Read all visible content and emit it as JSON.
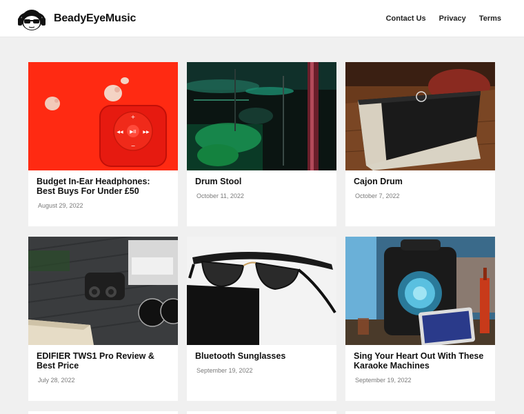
{
  "site": {
    "brand": "BeadyEyeMusic",
    "logo_icon": "headphones-face-logo-icon"
  },
  "nav": {
    "items": [
      {
        "label": "Contact Us"
      },
      {
        "label": "Privacy"
      },
      {
        "label": "Terms"
      }
    ]
  },
  "posts": [
    {
      "title": "Budget In-Ear Headphones: Best Buys For Under £50",
      "date": "August 29, 2022",
      "image": "red earbuds on red background"
    },
    {
      "title": "Drum Stool",
      "date": "October 11, 2022",
      "image": "drum kit with green lights"
    },
    {
      "title": "Cajon Drum",
      "date": "October 7, 2022",
      "image": "cajon drum on wooden floor"
    },
    {
      "title": "EDIFIER TWS1 Pro Review & Best Price",
      "date": "July 28, 2022",
      "image": "earbuds on desk with sunglasses"
    },
    {
      "title": "Bluetooth Sunglasses",
      "date": "September 19, 2022",
      "image": "black sunglasses on white"
    },
    {
      "title": "Sing Your Heart Out With These Karaoke Machines",
      "date": "September 19, 2022",
      "image": "karaoke speaker with tablet"
    }
  ],
  "colors": {
    "background": "#f0f0f0",
    "card": "#ffffff",
    "text": "#111111",
    "date": "#7a7a7a"
  }
}
